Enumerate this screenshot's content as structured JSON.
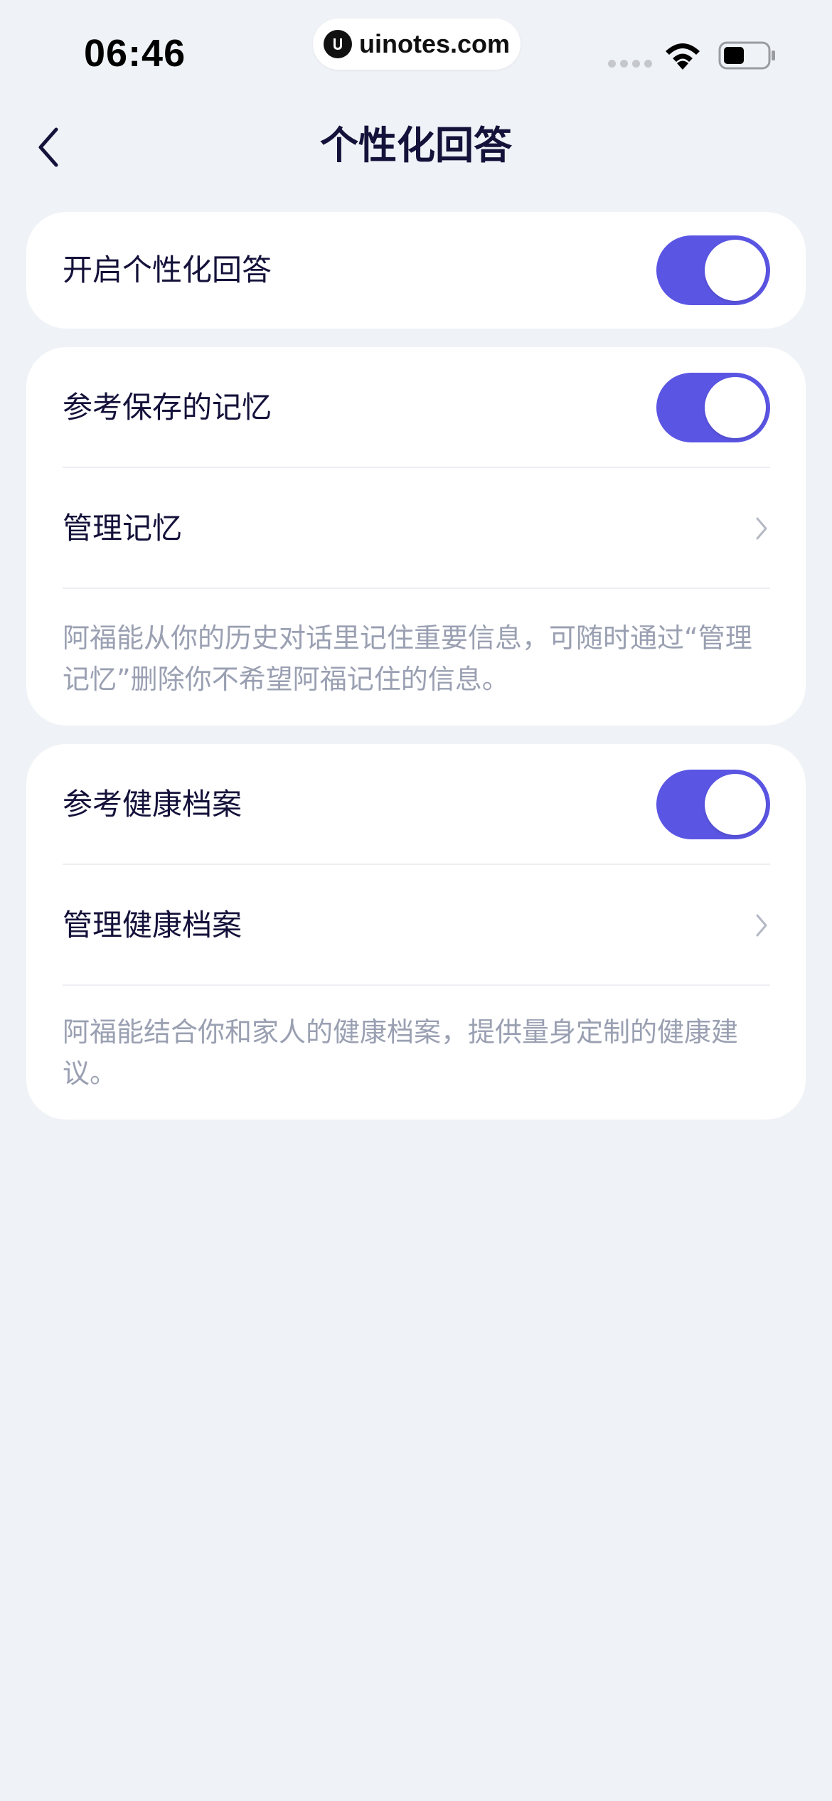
{
  "status_bar": {
    "time": "06:46",
    "watermark": "uinotes.com"
  },
  "nav": {
    "title": "个性化回答",
    "back_icon": "chevron-left-icon"
  },
  "sections": {
    "personalized": {
      "label": "开启个性化回答",
      "enabled": true
    },
    "memory": {
      "toggle_label": "参考保存的记忆",
      "toggle_enabled": true,
      "manage_label": "管理记忆",
      "description": "阿福能从你的历史对话里记住重要信息，可随时通过“管理记忆”删除你不希望阿福记住的信息。"
    },
    "health": {
      "toggle_label": "参考健康档案",
      "toggle_enabled": true,
      "manage_label": "管理健康档案",
      "description": "阿福能结合你和家人的健康档案，提供量身定制的健康建议。"
    }
  },
  "colors": {
    "toggle_on": "#5b55e4",
    "background": "#eff2f6",
    "card": "#ffffff",
    "text_primary": "#14123a",
    "text_secondary": "#9aa0b2"
  }
}
